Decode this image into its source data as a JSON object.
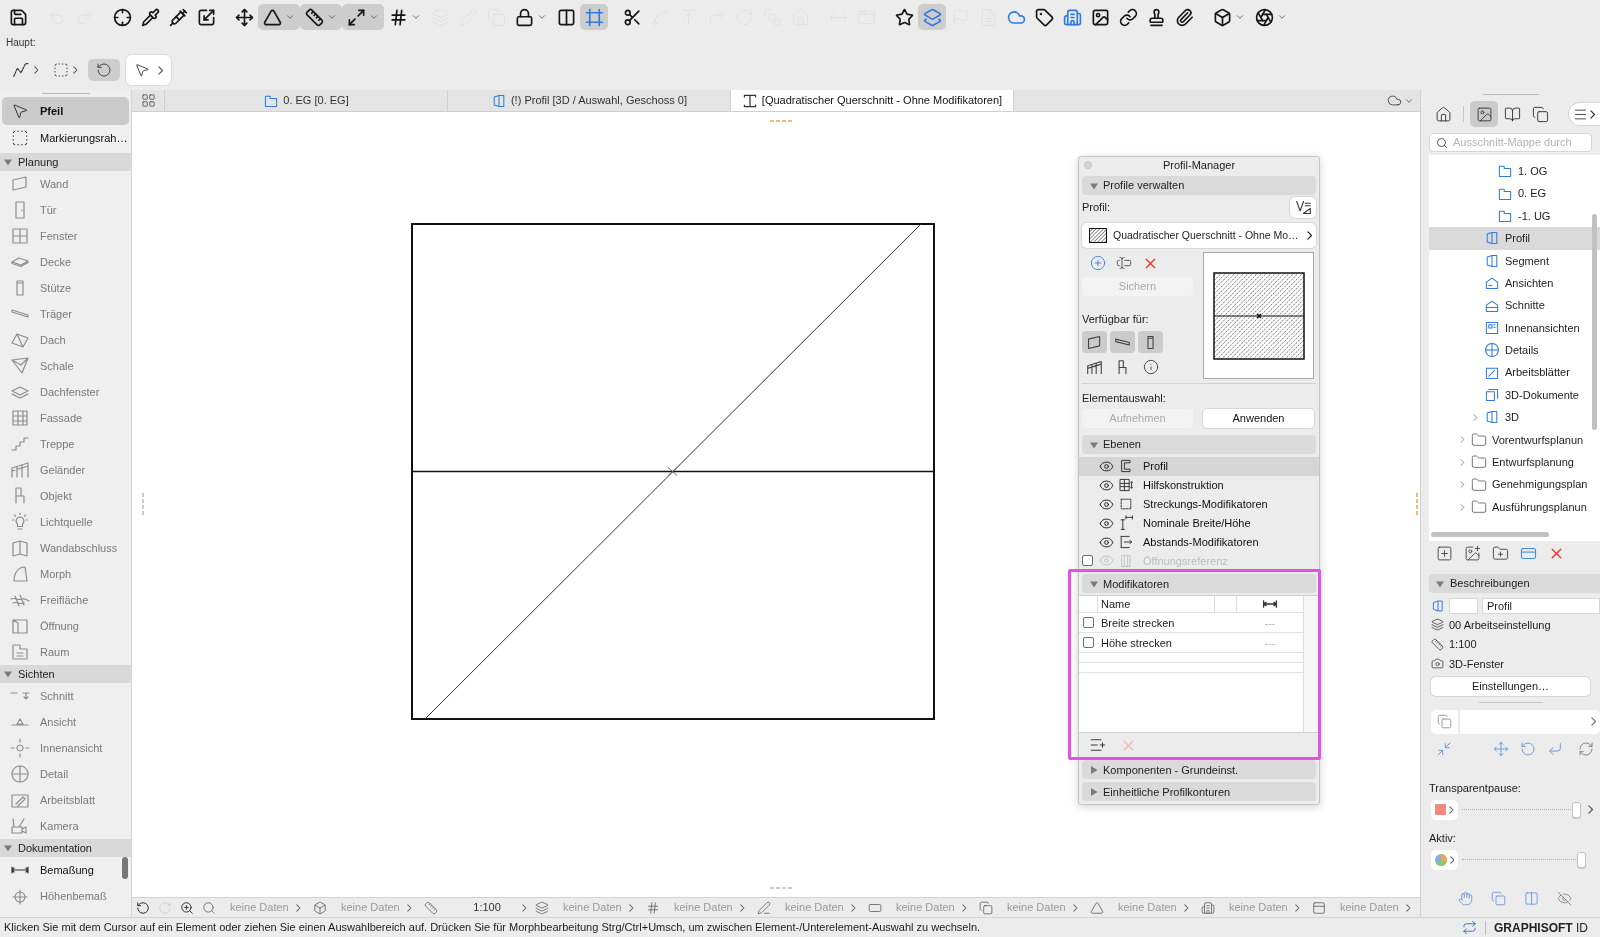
{
  "toolbar": {
    "buttons": [
      {
        "on": false,
        "disabled": false
      },
      {
        "on": false,
        "disabled": true
      },
      {
        "on": false,
        "disabled": true
      },
      {
        "on": false,
        "disabled": false
      },
      {
        "on": false,
        "disabled": false
      },
      {
        "on": false,
        "disabled": false
      },
      {
        "on": false,
        "disabled": false
      },
      {
        "on": false,
        "disabled": false
      },
      {
        "on": true,
        "disabled": false
      },
      {
        "on": true,
        "disabled": false
      },
      {
        "on": true,
        "disabled": false
      },
      {
        "on": false,
        "disabled": false
      },
      {
        "on": false,
        "disabled": true
      },
      {
        "on": false,
        "disabled": true
      },
      {
        "on": false,
        "disabled": true
      },
      {
        "on": false,
        "disabled": false
      },
      {
        "on": false,
        "disabled": false
      },
      {
        "on": true,
        "disabled": false
      },
      {
        "on": false,
        "disabled": false
      },
      {
        "on": false,
        "disabled": true
      },
      {
        "on": false,
        "disabled": true
      },
      {
        "on": false,
        "disabled": true
      },
      {
        "on": false,
        "disabled": true
      },
      {
        "on": false,
        "disabled": true
      },
      {
        "on": false,
        "disabled": true
      },
      {
        "on": false,
        "disabled": true
      },
      {
        "on": false,
        "disabled": true
      },
      {
        "on": false,
        "disabled": false
      },
      {
        "on": true,
        "disabled": false
      },
      {
        "on": false,
        "disabled": true
      },
      {
        "on": false,
        "disabled": true
      },
      {
        "on": false,
        "disabled": false
      },
      {
        "on": false,
        "disabled": false
      },
      {
        "on": false,
        "disabled": false
      },
      {
        "on": false,
        "disabled": false
      },
      {
        "on": false,
        "disabled": false
      },
      {
        "on": false,
        "disabled": false
      },
      {
        "on": false,
        "disabled": false
      },
      {
        "on": false,
        "disabled": false
      },
      {
        "on": false,
        "disabled": false
      }
    ]
  },
  "subtoolbar": {
    "title": "Haupt:",
    "buttons": [
      {
        "kind": "menu",
        "on": false
      },
      {
        "kind": "menu",
        "on": false
      },
      {
        "kind": "toggle",
        "on": true
      },
      {
        "kind": "pointer",
        "on": false
      }
    ]
  },
  "toolbox": {
    "tools": [
      {
        "label": "Pfeil",
        "kind": "arrow",
        "selected": true,
        "disabled": false
      },
      {
        "label": "Markierungsrah…",
        "kind": "marquee",
        "selected": false,
        "disabled": false
      }
    ],
    "groups": [
      {
        "title": "Planung",
        "expanded": true,
        "items": [
          {
            "label": "Wand",
            "kind": "wall",
            "selected": false,
            "disabled": true
          },
          {
            "label": "Tür",
            "kind": "door",
            "selected": false,
            "disabled": true
          },
          {
            "label": "Fenster",
            "kind": "window",
            "selected": false,
            "disabled": true
          },
          {
            "label": "Decke",
            "kind": "slab",
            "selected": false,
            "disabled": true
          },
          {
            "label": "Stütze",
            "kind": "column",
            "selected": false,
            "disabled": true
          },
          {
            "label": "Träger",
            "kind": "beam",
            "selected": false,
            "disabled": true
          },
          {
            "label": "Dach",
            "kind": "roof",
            "selected": false,
            "disabled": true
          },
          {
            "label": "Schale",
            "kind": "shell",
            "selected": false,
            "disabled": true
          },
          {
            "label": "Dachfenster",
            "kind": "skylight",
            "selected": false,
            "disabled": true
          },
          {
            "label": "Fassade",
            "kind": "curtain",
            "selected": false,
            "disabled": true
          },
          {
            "label": "Treppe",
            "kind": "stair",
            "selected": false,
            "disabled": true
          },
          {
            "label": "Geländer",
            "kind": "railing",
            "selected": false,
            "disabled": true
          },
          {
            "label": "Objekt",
            "kind": "object",
            "selected": false,
            "disabled": true
          },
          {
            "label": "Lichtquelle",
            "kind": "lamp",
            "selected": false,
            "disabled": true
          },
          {
            "label": "Wandabschluss",
            "kind": "wallend",
            "selected": false,
            "disabled": true
          },
          {
            "label": "Morph",
            "kind": "morph",
            "selected": false,
            "disabled": true
          },
          {
            "label": "Freifläche",
            "kind": "mesh",
            "selected": false,
            "disabled": true
          },
          {
            "label": "Öffnung",
            "kind": "opening",
            "selected": false,
            "disabled": true
          },
          {
            "label": "Raum",
            "kind": "zone",
            "selected": false,
            "disabled": true
          }
        ]
      },
      {
        "title": "Sichten",
        "expanded": true,
        "items": [
          {
            "label": "Schnitt",
            "kind": "section",
            "selected": false,
            "disabled": true
          },
          {
            "label": "Ansicht",
            "kind": "elevation",
            "selected": false,
            "disabled": true
          },
          {
            "label": "Innenansicht",
            "kind": "interior",
            "selected": false,
            "disabled": true
          },
          {
            "label": "Detail",
            "kind": "detail",
            "selected": false,
            "disabled": true
          },
          {
            "label": "Arbeitsblatt",
            "kind": "worksheet",
            "selected": false,
            "disabled": true
          },
          {
            "label": "Kamera",
            "kind": "camera",
            "selected": false,
            "disabled": true
          }
        ]
      },
      {
        "title": "Dokumentation",
        "expanded": true,
        "items": [
          {
            "label": "Bemaßung",
            "kind": "dimension",
            "selected": false,
            "disabled": false
          },
          {
            "label": "Höhenbemaß",
            "kind": "level",
            "selected": false,
            "disabled": true
          }
        ]
      }
    ]
  },
  "tabs": [
    {
      "label": "0. EG [0. EG]",
      "kind": "plan",
      "selected": false
    },
    {
      "label": "(!) Profil [3D / Auswahl, Geschoss 0]",
      "kind": "model",
      "selected": false
    },
    {
      "label": "[Quadratischer Querschnitt - Ohne Modifikatoren]",
      "kind": "profile",
      "selected": true
    }
  ],
  "profile_manager": {
    "title": "Profil-Manager",
    "sections": [
      {
        "kind": "manage",
        "title": "Profile verwalten",
        "expanded": true,
        "profile_label": "Profil:",
        "profile_value": "Quadratischer Querschnitt - Ohne Mo…",
        "save_button": {
          "label": "Sichern",
          "disabled": true
        },
        "available_label": "Verfügbar für:",
        "available_for": [
          {
            "kind": "wall",
            "selected": true
          },
          {
            "kind": "beam",
            "selected": true
          },
          {
            "kind": "column",
            "selected": true
          },
          {
            "kind": "railing",
            "selected": false
          },
          {
            "kind": "object",
            "selected": false
          },
          {
            "kind": "info",
            "selected": false
          }
        ],
        "selection_label": "Elementauswahl:",
        "selection_buttons": [
          {
            "label": "Aufnehmen",
            "disabled": true
          },
          {
            "label": "Anwenden",
            "disabled": false
          }
        ]
      },
      {
        "kind": "layers",
        "title": "Ebenen",
        "expanded": true,
        "items": [
          {
            "label": "Profil",
            "kind": "profile",
            "selected": true
          },
          {
            "label": "Hilfskonstruktion",
            "kind": "construction",
            "selected": false
          },
          {
            "label": "Streckungs-Modifikatoren",
            "kind": "stretch",
            "selected": false
          },
          {
            "label": "Nominale Breite/Höhe",
            "kind": "nominal",
            "selected": false
          },
          {
            "label": "Abstands-Modifikatoren",
            "kind": "offset",
            "selected": false
          },
          {
            "label": "Öffnungsreferenz",
            "kind": "opening",
            "selected": false,
            "checked": false
          }
        ]
      },
      {
        "kind": "modifiers",
        "title": "Modifikatoren",
        "expanded": true,
        "name_column": "Name",
        "rows": [
          {
            "name": "Breite strecken",
            "checked": false,
            "value": "---"
          },
          {
            "name": "Höhe strecken",
            "checked": false,
            "value": "---"
          }
        ],
        "actions": [
          {
            "kind": "add",
            "disabled": false
          },
          {
            "kind": "delete",
            "disabled": true
          }
        ]
      },
      {
        "kind": "plain",
        "title": "Komponenten - Grundeinst.",
        "expanded": false
      },
      {
        "kind": "plain",
        "title": "Einheitliche Profilkonturen",
        "expanded": false
      }
    ]
  },
  "quick_options": {
    "nav_buttons": [
      {
        "kind": "undo_view",
        "disabled": false
      },
      {
        "kind": "redo_view",
        "disabled": true
      },
      {
        "kind": "zoom_in",
        "disabled": false
      }
    ],
    "items": [
      {
        "kind": "zoom",
        "value": "keine Daten"
      },
      {
        "kind": "transform",
        "value": "keine Daten"
      },
      {
        "kind": "scale",
        "value": "1:100"
      },
      {
        "kind": "layers",
        "value": "keine Daten"
      },
      {
        "kind": "fill",
        "value": "keine Daten"
      },
      {
        "kind": "pen",
        "value": "keine Daten"
      },
      {
        "kind": "view",
        "value": "keine Daten"
      },
      {
        "kind": "copies",
        "value": "keine Daten"
      },
      {
        "kind": "structure",
        "value": "keine Daten"
      },
      {
        "kind": "building",
        "value": "keine Daten"
      },
      {
        "kind": "panel",
        "value": "keine Daten"
      }
    ]
  },
  "navigator": {
    "view_buttons": [
      {
        "selected": false
      },
      {
        "selected": true
      },
      {
        "selected": false
      },
      {
        "selected": false
      }
    ],
    "search": {
      "placeholder": "Ausschnitt-Mappe durch"
    },
    "tree": [
      {
        "children": [
          {
            "children": [
              {
                "label": "1. OG",
                "kind": "story",
                "selected": false
              },
              {
                "label": "0. EG",
                "kind": "story",
                "selected": false
              },
              {
                "label": "-1. UG",
                "kind": "story",
                "selected": false
              }
            ]
          },
          {
            "label": "Profil",
            "kind": "profile",
            "selected": true
          },
          {
            "label": "Segment",
            "kind": "profile",
            "selected": false
          },
          {
            "label": "Ansichten",
            "kind": "elevation",
            "selected": false
          },
          {
            "label": "Schnitte",
            "kind": "section",
            "selected": false
          },
          {
            "label": "Innenansichten",
            "kind": "interior",
            "selected": false
          },
          {
            "label": "Details",
            "kind": "detail",
            "selected": false
          },
          {
            "label": "Arbeitsblätter",
            "kind": "worksheet",
            "selected": false
          },
          {
            "label": "3D-Dokumente",
            "kind": "document3d",
            "selected": false
          },
          {
            "label": "3D",
            "kind": "view3d",
            "selected": false,
            "expanded": false
          }
        ]
      },
      {
        "label": "Vorentwurfsplanun",
        "kind": "folder",
        "selected": false,
        "expanded": false
      },
      {
        "label": "Entwurfsplanung",
        "kind": "folder",
        "selected": false,
        "expanded": false
      },
      {
        "label": "Genehmigungsplan",
        "kind": "folder",
        "selected": false,
        "expanded": false
      },
      {
        "label": "Ausführungsplanun",
        "kind": "folder",
        "selected": false,
        "expanded": false
      }
    ],
    "details": {
      "title": "Beschreibungen",
      "expanded": true,
      "name_value": "Profil",
      "rows": [
        {
          "kind": "layers",
          "text": "00 Arbeitseinstellung"
        },
        {
          "kind": "scale",
          "text": "1:100"
        },
        {
          "kind": "camera",
          "text": "3D-Fenster"
        }
      ],
      "settings_button": "Einstellungen…"
    },
    "trace": {
      "label": "Transparentpause:",
      "level": 1
    },
    "active": {
      "label": "Aktiv:",
      "level": 1
    }
  },
  "status_bar": {
    "message": "Klicken Sie mit dem Cursor auf ein Element oder ziehen Sie einen Auswahlbereich auf. Drücken Sie für Morphbearbeitung Strg/Ctrl+Umsch, um zwischen Element-/Unterelement-Auswahl zu wechseln.",
    "account": "**GRAPHISOFT** ID"
  }
}
